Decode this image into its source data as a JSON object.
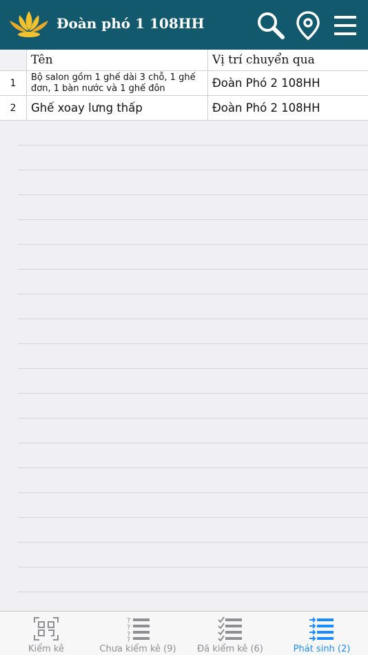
{
  "header": {
    "title": "Đoàn phó 1 108HH",
    "logo_icon": "lotus-logo-icon",
    "actions": [
      "search-icon",
      "location-pin-icon",
      "menu-icon"
    ],
    "color": "#13596e"
  },
  "table": {
    "columns": [
      "",
      "Tên",
      "Vị trí chuyển qua"
    ],
    "rows": [
      {
        "index": "1",
        "name": "Bộ salon gồm 1 ghế dài 3 chỗ, 1 ghế đơn, 1 bàn nước và 1 ghế đôn",
        "location": "Đoàn Phó 2 108HH"
      },
      {
        "index": "2",
        "name": "Ghế xoay lưng thấp",
        "location": "Đoàn Phó 2 108HH"
      }
    ]
  },
  "tabs": [
    {
      "label": "Kiểm kê",
      "icon": "qr-scan-icon",
      "active": false
    },
    {
      "label": "Chưa kiểm kê (9)",
      "icon": "question-list-icon",
      "active": false
    },
    {
      "label": "Đã kiểm kê (6)",
      "icon": "checked-list-icon",
      "active": false
    },
    {
      "label": "Phát sinh (2)",
      "icon": "arrow-list-icon",
      "active": true
    }
  ],
  "colors": {
    "active_tab": "#1a8cff",
    "inactive_tab": "#8e8e93"
  }
}
